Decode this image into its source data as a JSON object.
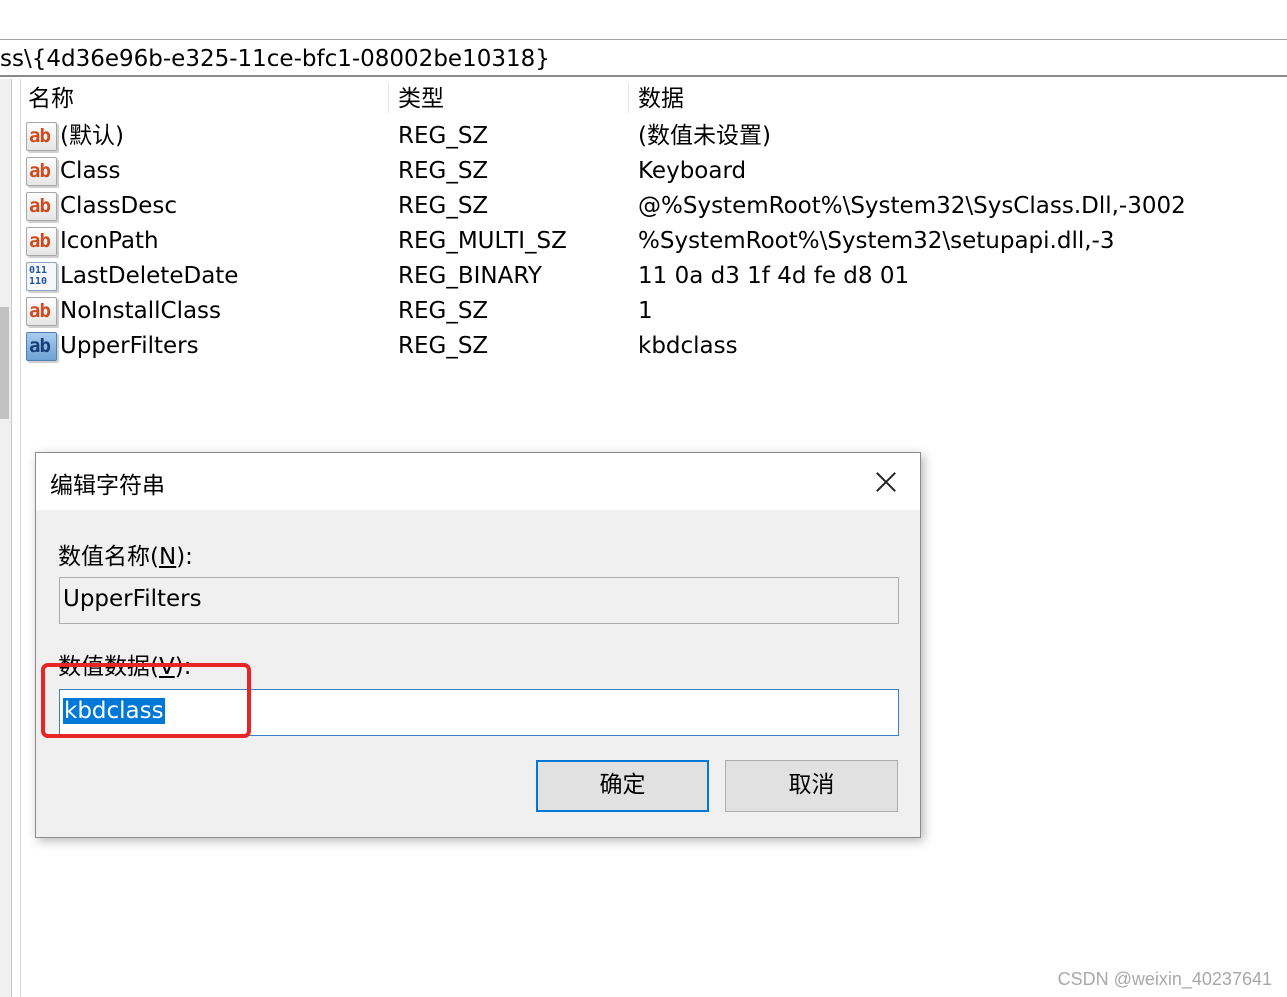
{
  "address_bar": {
    "path": "ss\\{4d36e96b-e325-11ce-bfc1-08002be10318}"
  },
  "list": {
    "columns": {
      "name": "名称",
      "type": "类型",
      "data": "数据"
    },
    "rows": [
      {
        "icon": "string-value-icon",
        "name": "(默认)",
        "type": "REG_SZ",
        "data": "(数值未设置)"
      },
      {
        "icon": "string-value-icon",
        "name": "Class",
        "type": "REG_SZ",
        "data": "Keyboard"
      },
      {
        "icon": "string-value-icon",
        "name": "ClassDesc",
        "type": "REG_SZ",
        "data": "@%SystemRoot%\\System32\\SysClass.Dll,-3002"
      },
      {
        "icon": "string-value-icon",
        "name": "IconPath",
        "type": "REG_MULTI_SZ",
        "data": "%SystemRoot%\\System32\\setupapi.dll,-3"
      },
      {
        "icon": "binary-value-icon",
        "name": "LastDeleteDate",
        "type": "REG_BINARY",
        "data": "11 0a d3 1f 4d fe d8 01"
      },
      {
        "icon": "string-value-icon",
        "name": "NoInstallClass",
        "type": "REG_SZ",
        "data": "1"
      },
      {
        "icon": "string-value-icon",
        "name": "UpperFilters",
        "type": "REG_SZ",
        "data": "kbdclass"
      }
    ],
    "icon_glyphs": {
      "string": "ab",
      "binary_top": "011",
      "binary_bottom": "110"
    }
  },
  "dialog": {
    "title": "编辑字符串",
    "name_label": "数值名称(",
    "name_label_key": "N",
    "name_label_end": "):",
    "name_value": "UpperFilters",
    "data_label": "数值数据(",
    "data_label_key": "V",
    "data_label_end": "):",
    "data_value": "kbdclass",
    "ok_label": "确定",
    "cancel_label": "取消"
  },
  "colors": {
    "selection": "#0078d7",
    "highlight_box": "#e82424",
    "dialog_bg": "#f0f0f0"
  },
  "watermark": "CSDN @weixin_40237641"
}
